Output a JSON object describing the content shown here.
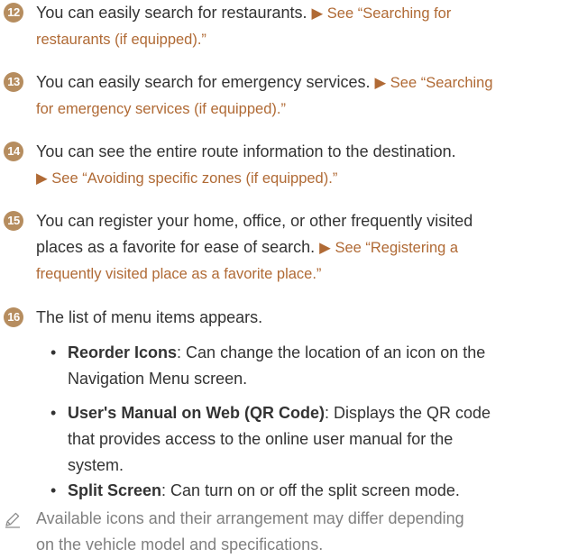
{
  "items": [
    {
      "number": "12",
      "lines": [
        {
          "text": "You can easily search for restaurants. ",
          "ref": "▶ See “Searching for"
        },
        {
          "text": "",
          "ref": "restaurants (if equipped).”"
        }
      ]
    },
    {
      "number": "13",
      "lines": [
        {
          "text": "You can easily search for emergency services. ",
          "ref": "▶ See “Searching"
        },
        {
          "text": "",
          "ref": "for emergency services (if equipped).”"
        }
      ]
    },
    {
      "number": "14",
      "lines": [
        {
          "text": "You can see the entire route information to the destination.",
          "ref": ""
        },
        {
          "text": "",
          "ref": "▶ See “Avoiding specific zones (if equipped).”"
        }
      ]
    },
    {
      "number": "15",
      "lines": [
        {
          "text": "You can register your home, office, or other frequently visited",
          "ref": ""
        },
        {
          "text": "places as a favorite for ease of search. ",
          "ref": "▶ See “Registering a"
        },
        {
          "text": "",
          "ref": "frequently visited place as a favorite place.”"
        }
      ]
    },
    {
      "number": "16",
      "lines": [
        {
          "text": "The list of menu items appears.",
          "ref": ""
        }
      ]
    }
  ],
  "menu_items": [
    {
      "term": "Reorder Icons",
      "lines": [
        ": Can change the location of an icon on the",
        "Navigation Menu screen."
      ]
    },
    {
      "term": "User's Manual on Web (QR Code)",
      "lines": [
        ": Displays the QR code",
        "that provides access to the online user manual for the",
        "system."
      ]
    },
    {
      "term": "Split Screen",
      "lines": [
        ": Can turn on or off the split screen mode."
      ]
    }
  ],
  "note": {
    "lines": [
      "Available icons and their arrangement may differ depending",
      "on the vehicle model and specifications."
    ]
  },
  "colors": {
    "badge": "#b68d5f",
    "reference": "#b06a35",
    "body_text": "#333333",
    "note_text": "#808080"
  }
}
